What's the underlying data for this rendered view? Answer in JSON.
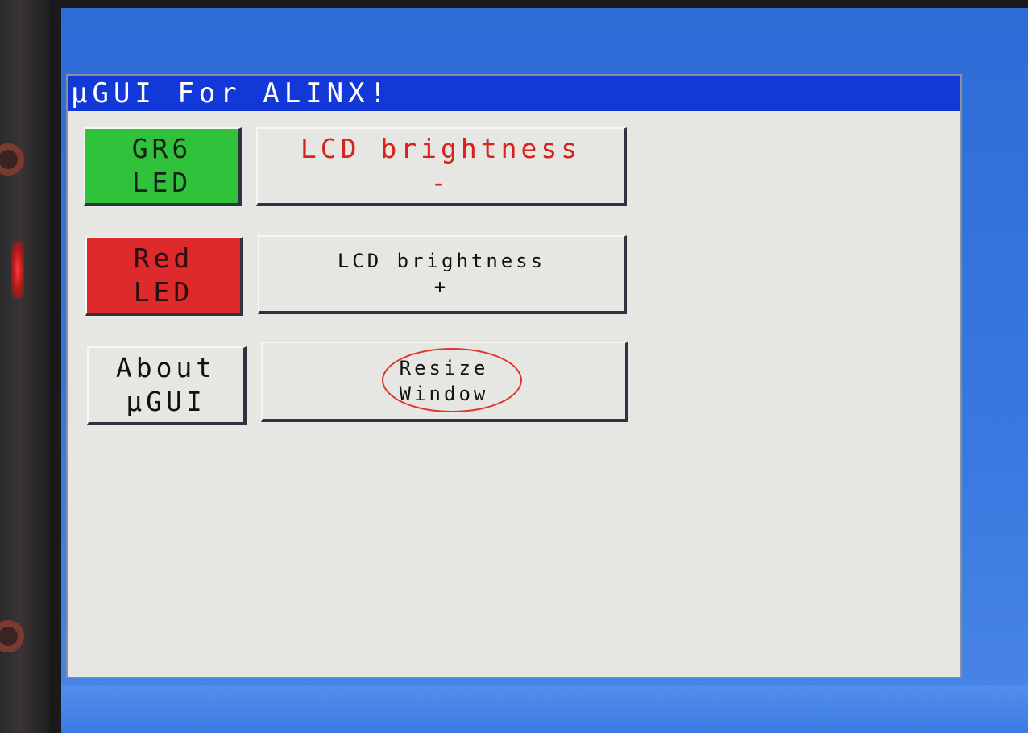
{
  "window": {
    "title": "µGUI For ALINX!"
  },
  "buttons": {
    "green_led": {
      "line1": "GR6",
      "line2": "LED"
    },
    "red_led": {
      "line1": "Red",
      "line2": "LED"
    },
    "about": {
      "line1": "About",
      "line2": "µGUI"
    },
    "lcd_minus": {
      "line1": "LCD brightness",
      "line2": "-"
    },
    "lcd_plus": {
      "line1": "LCD brightness",
      "line2": "+"
    },
    "resize": {
      "line1": "Resize",
      "line2": "Window"
    }
  },
  "colors": {
    "title_bar": "#1238d8",
    "window_bg": "#e6e7e2",
    "green_button": "#30c23a",
    "red_button": "#de2a2a",
    "lcd_minus_text": "#d8221c",
    "screen_bg": "#3a78e0",
    "highlight_annotation": "#e0312b"
  }
}
